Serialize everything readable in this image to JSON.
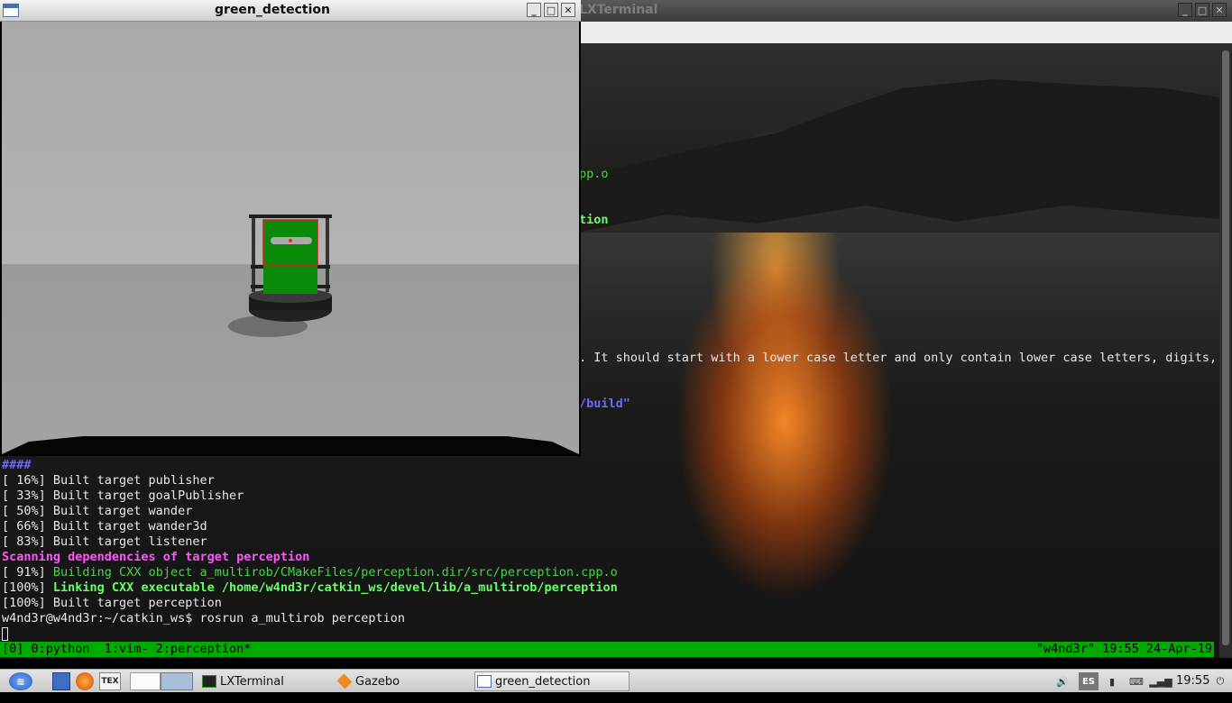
{
  "terminal": {
    "title": "LXTerminal",
    "partial_lines": {
      "l1": "pp.o",
      "l2": "tion",
      "l3": ". It should start with a lower case letter and only contain lower case letters, digits,",
      "l4": "/build\""
    },
    "hash_line": "####",
    "lines": [
      "[ 16%] Built target publisher",
      "[ 33%] Built target goalPublisher",
      "[ 50%] Built target wander",
      "[ 66%] Built target wander3d",
      "[ 83%] Built target listener"
    ],
    "scanning": "Scanning dependencies of target perception",
    "building_prefix": "[ 91%] ",
    "building": "Building CXX object a_multirob/CMakeFiles/perception.dir/src/perception.cpp.o",
    "linking_prefix": "[100%] ",
    "linking": "Linking CXX executable /home/w4nd3r/catkin_ws/devel/lib/a_multirob/perception",
    "built_perception": "[100%] Built target perception",
    "prompt": "w4nd3r@w4nd3r:~/catkin_ws$ rosrun a_multirob perception"
  },
  "tmux": {
    "left": "[0] 0:python  1:vim- 2:perception*",
    "right": "\"w4nd3r\" 19:55 24-Apr-19"
  },
  "green_detection": {
    "title": "green_detection"
  },
  "window_buttons": {
    "minimize": "_",
    "maximize": "□",
    "close": "✕"
  },
  "taskbar": {
    "tasks": {
      "lxterminal": "LXTerminal",
      "gazebo": "Gazebo",
      "green_detection": "green_detection"
    },
    "tex_icon": "TEX",
    "tray_lang": "ES",
    "clock": "19:55"
  },
  "colors": {
    "tmux_green": "#00aa00",
    "term_green": "#4bd34b",
    "term_magenta": "#ff55ff"
  }
}
